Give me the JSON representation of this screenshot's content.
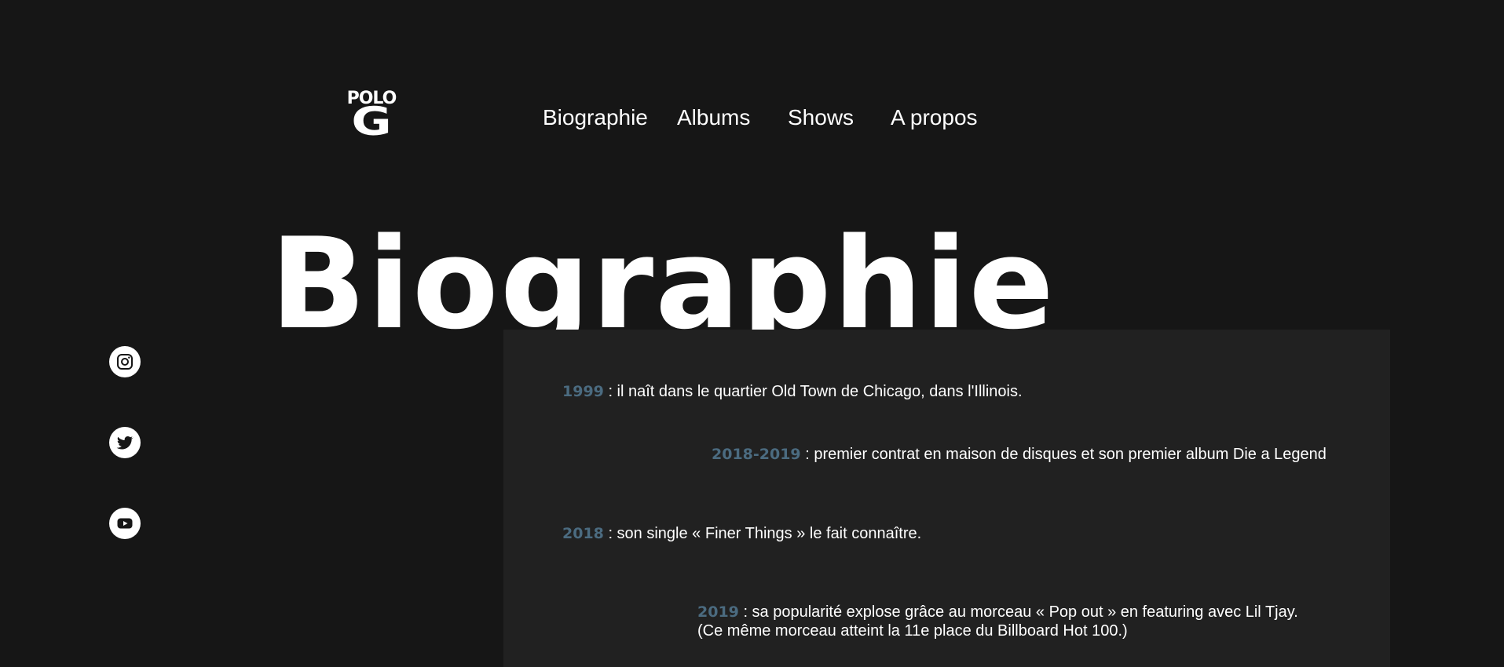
{
  "logo": {
    "line1": "POLO",
    "line2": "G"
  },
  "nav": {
    "items": [
      "Biographie",
      "Albums",
      "Shows",
      "A propos"
    ]
  },
  "hero": {
    "title": "Biographie"
  },
  "social": [
    {
      "icon": "instagram-icon"
    },
    {
      "icon": "twitter-icon"
    },
    {
      "icon": "youtube-icon"
    }
  ],
  "timeline": [
    {
      "year": "1999",
      "text": " : il naît dans le quartier Old Town de Chicago, dans l'Illinois."
    },
    {
      "year": "2018-2019",
      "text": " : premier contrat en maison de disques et son premier album Die a Legend"
    },
    {
      "year": "2018",
      "text": " : son single « Finer Things » le fait connaître."
    },
    {
      "year": "2019",
      "text": " : sa popularité explose grâce au morceau « Pop out » en featuring avec Lil Tjay.",
      "text2": "(Ce même morceau atteint la 11e place du Billboard Hot 100.)"
    }
  ],
  "colors": {
    "background": "#161616",
    "panel": "#212121",
    "year_accent": "#4b6b80"
  }
}
